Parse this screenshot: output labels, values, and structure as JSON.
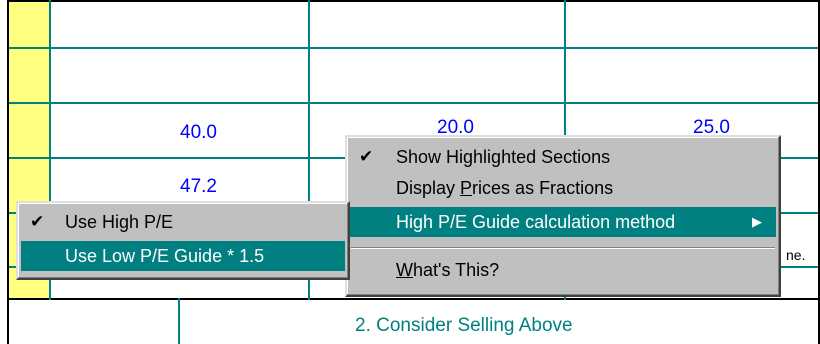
{
  "grid": {
    "row3": [
      "40.0",
      "20.0",
      "25.0"
    ],
    "row4": [
      "47.2"
    ],
    "truncated_text": "ne.",
    "section_heading": "2. Consider Selling Above"
  },
  "context_menu": {
    "items": [
      {
        "label_pre": "Show Hi",
        "label_u": "g",
        "label_post": "hlighted Sections",
        "checked": true
      },
      {
        "label_pre": "Display ",
        "label_u": "P",
        "label_post": "rices as Fractions",
        "checked": false
      },
      {
        "label": "High P/E Guide calculation method",
        "has_submenu": true,
        "highlighted": true
      },
      {
        "label_pre": "",
        "label_u": "W",
        "label_post": "hat's This?",
        "checked": false
      }
    ]
  },
  "submenu": {
    "items": [
      {
        "label": "Use High P/E",
        "checked": true
      },
      {
        "label": "Use Low P/E Guide * 1.5",
        "checked": false,
        "highlighted": true
      }
    ]
  },
  "colors": {
    "grid_line": "#008080",
    "highlight_column": "#ffff80",
    "menu_bg": "#c0c0c0",
    "menu_highlight": "#008080",
    "number_text": "#0000ff"
  }
}
